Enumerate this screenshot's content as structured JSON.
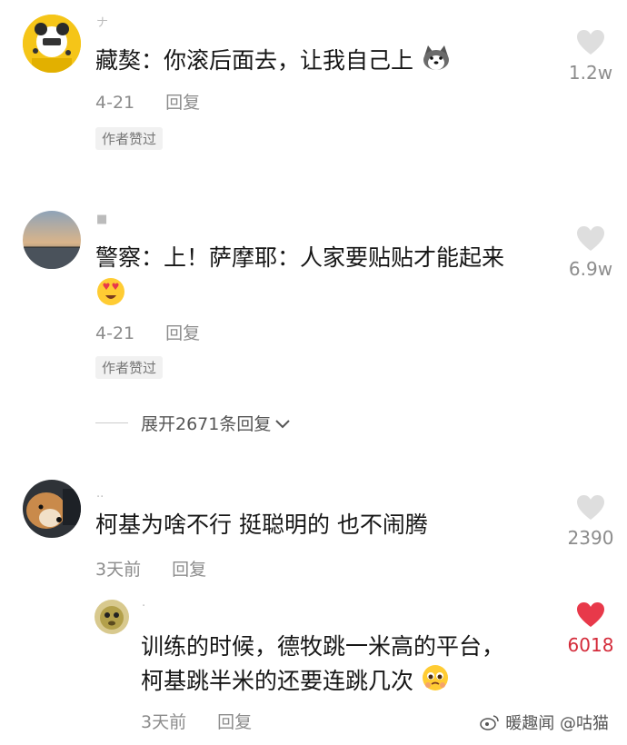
{
  "comments": [
    {
      "username": "ナ",
      "text": "藏獒：你滚后面去，让我自己上",
      "emoji": "husky-emoji",
      "date": "4-21",
      "reply_label": "回复",
      "badge": "作者赞过",
      "likes": "1.2w",
      "liked": false
    },
    {
      "username": "■",
      "text": "警察：上！萨摩耶：人家要贴贴才能起来",
      "emoji": "heart-eyes-emoji",
      "date": "4-21",
      "reply_label": "回复",
      "badge": "作者赞过",
      "likes": "6.9w",
      "liked": false
    },
    {
      "username": "..",
      "text": "柯基为啥不行 挺聪明的 也不闹腾",
      "date": "3天前",
      "reply_label": "回复",
      "likes": "2390",
      "liked": false
    },
    {
      "username": "·",
      "text_line1": "训练的时候，德牧跳一米高的平台，",
      "text_line2": "柯基跳半米的还要连跳几次",
      "emoji": "pleading-face-emoji",
      "date": "3天前",
      "reply_label": "回复",
      "likes": "6018",
      "liked": true
    }
  ],
  "expand_replies": "展开2671条回复",
  "watermark": "暖趣闻 @咕猫",
  "colors": {
    "like_active": "#e8394a",
    "like_inactive": "#dedede",
    "text": "#161616",
    "meta": "#8c8c8c"
  }
}
